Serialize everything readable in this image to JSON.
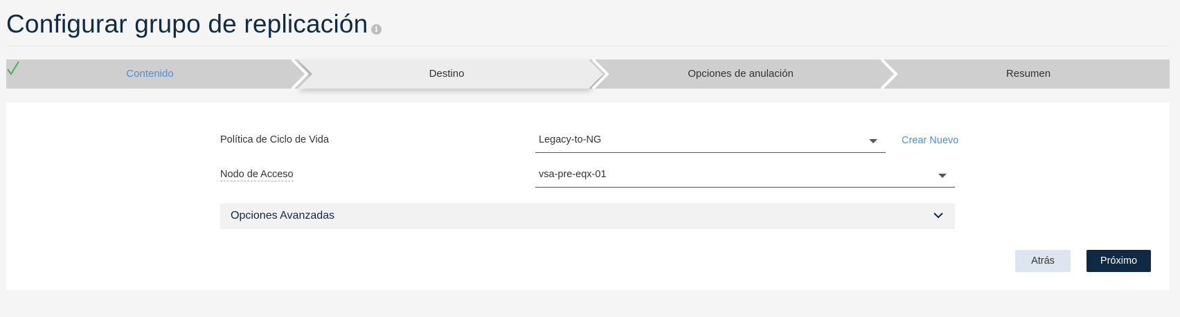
{
  "header": {
    "title": "Configurar grupo de replicación",
    "info_icon": "info-icon"
  },
  "wizard": {
    "steps": [
      {
        "label": "Contenido",
        "state": "completed"
      },
      {
        "label": "Destino",
        "state": "active"
      },
      {
        "label": "Opciones de anulación",
        "state": "pending"
      },
      {
        "label": "Resumen",
        "state": "pending"
      }
    ],
    "colors": {
      "completed_text": "#4a90d9",
      "active_bg": "#ececec",
      "pending_bg": "#cfcfcf",
      "check": "#4caf50"
    }
  },
  "form": {
    "lifecycle_policy": {
      "label": "Política de Ciclo de Vida",
      "value": "Legacy-to-NG",
      "create_new": "Crear Nuevo"
    },
    "access_node": {
      "label": "Nodo de Acceso",
      "value": "vsa-pre-eqx-01"
    },
    "advanced": {
      "label": "Opciones Avanzadas",
      "icon": "chevron-down-icon"
    }
  },
  "buttons": {
    "back": "Atrás",
    "next": "Próximo"
  },
  "colors": {
    "primary": "#0e2a45",
    "link": "#4a90d9",
    "background": "#f5f5f5"
  }
}
